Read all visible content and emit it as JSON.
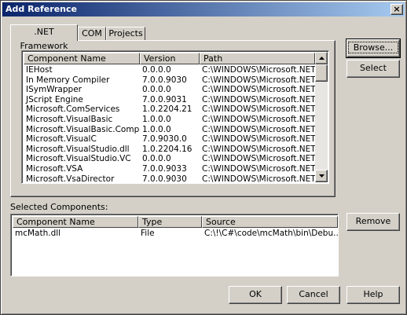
{
  "window": {
    "title": "Add Reference",
    "close_label": "×"
  },
  "tabs": [
    {
      "label": ".NET Framework"
    },
    {
      "label": "COM"
    },
    {
      "label": "Projects"
    }
  ],
  "components_list": {
    "columns": [
      "Component Name",
      "Version",
      "Path"
    ],
    "rows": [
      [
        "IEHost",
        "0.0.0.0",
        "C:\\WINDOWS\\Microsoft.NET\\..."
      ],
      [
        "In Memory Compiler",
        "7.0.0.9030",
        "C:\\WINDOWS\\Microsoft.NET\\..."
      ],
      [
        "ISymWrapper",
        "0.0.0.0",
        "C:\\WINDOWS\\Microsoft.NET\\..."
      ],
      [
        "JScript Engine",
        "7.0.0.9031",
        "C:\\WINDOWS\\Microsoft.NET\\..."
      ],
      [
        "Microsoft.ComServices",
        "1.0.2204.21",
        "C:\\WINDOWS\\Microsoft.NET\\..."
      ],
      [
        "Microsoft.VisualBasic",
        "1.0.0.0",
        "C:\\WINDOWS\\Microsoft.NET\\..."
      ],
      [
        "Microsoft.VisualBasic.Compati...",
        "1.0.0.0",
        "C:\\WINDOWS\\Microsoft.NET\\..."
      ],
      [
        "Microsoft.VisualC",
        "7.0.9030.0",
        "C:\\WINDOWS\\Microsoft.NET\\..."
      ],
      [
        "Microsoft.VisualStudio.dll",
        "1.0.2204.16",
        "C:\\WINDOWS\\Microsoft.NET\\..."
      ],
      [
        "Microsoft.VisualStudio.VC",
        "0.0.0.0",
        "C:\\WINDOWS\\Microsoft.NET\\..."
      ],
      [
        "Microsoft.VSA",
        "7.0.0.9033",
        "C:\\WINDOWS\\Microsoft.NET\\..."
      ],
      [
        "Microsoft.VsaDirector",
        "7.0.0.9030",
        "C:\\WINDOWS\\Microsoft.NET\\..."
      ]
    ]
  },
  "buttons": {
    "browse": "Browse...",
    "select": "Select",
    "remove": "Remove",
    "ok": "OK",
    "cancel": "Cancel",
    "help": "Help"
  },
  "selected_section": {
    "label": "Selected Components:",
    "columns": [
      "Component Name",
      "Type",
      "Source"
    ],
    "rows": [
      [
        "mcMath.dll",
        "File",
        "C:\\!\\C#\\code\\mcMath\\bin\\Debu..."
      ]
    ]
  },
  "icons": {
    "scroll_up": "arrow-up-icon",
    "scroll_down": "arrow-down-icon"
  },
  "colors": {
    "titlebar_start": "#0a246a",
    "titlebar_end": "#a6caf0",
    "face": "#d4d0c8"
  }
}
